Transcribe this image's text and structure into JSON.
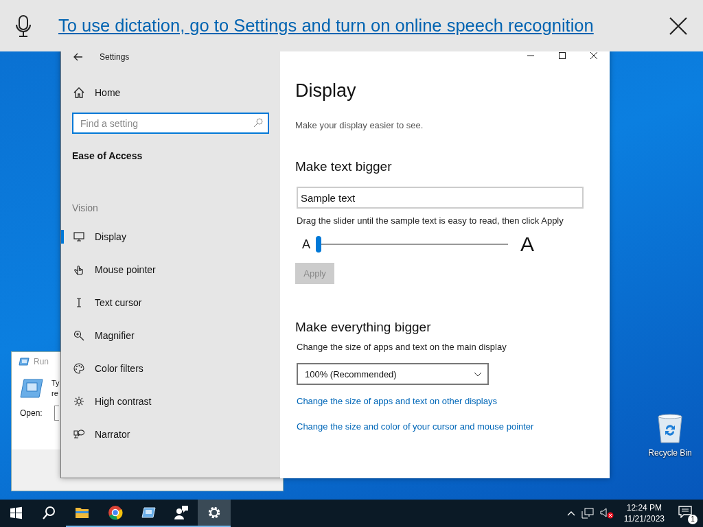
{
  "dictation_bar": {
    "message": "To use dictation, go to Settings and turn on online speech recognition"
  },
  "run_dialog": {
    "title": "Run",
    "description_lines": [
      "Ty",
      "re"
    ],
    "open_label": "Open:"
  },
  "settings": {
    "title": "Settings",
    "home": "Home",
    "search": {
      "placeholder": "Find a setting"
    },
    "category": "Ease of Access",
    "section": "Vision",
    "nav_items": [
      {
        "label": "Display",
        "kind": "display",
        "selected": true
      },
      {
        "label": "Mouse pointer",
        "kind": "pointer",
        "selected": false
      },
      {
        "label": "Text cursor",
        "kind": "cursor",
        "selected": false
      },
      {
        "label": "Magnifier",
        "kind": "magnifier",
        "selected": false
      },
      {
        "label": "Color filters",
        "kind": "palette",
        "selected": false
      },
      {
        "label": "High contrast",
        "kind": "contrast",
        "selected": false
      },
      {
        "label": "Narrator",
        "kind": "narrator",
        "selected": false
      }
    ],
    "page": {
      "title": "Display",
      "description": "Make your display easier to see.",
      "text_section": {
        "heading": "Make text bigger",
        "sample_value": "Sample text",
        "instruction": "Drag the slider until the sample text is easy to read, then click Apply",
        "slider": {
          "min_label": "A",
          "max_label": "A",
          "level": 0
        },
        "apply": {
          "label": "Apply",
          "disabled": true
        }
      },
      "everything_section": {
        "heading": "Make everything bigger",
        "caption": "Change the size of apps and text on the main display",
        "scale": {
          "value": "100% (Recommended)"
        },
        "links": [
          "Change the size of apps and text on other displays",
          "Change the size and color of your cursor and mouse pointer"
        ]
      }
    }
  },
  "desktop_icons": [
    {
      "label": "Recycle Bin"
    }
  ],
  "taskbar": {
    "apps": [
      {
        "kind": "start",
        "running": false,
        "selected": false
      },
      {
        "kind": "search",
        "running": false,
        "selected": false
      },
      {
        "kind": "folder",
        "running": true,
        "selected": false
      },
      {
        "kind": "browser",
        "running": true,
        "selected": false
      },
      {
        "kind": "run",
        "running": true,
        "selected": false
      },
      {
        "kind": "people",
        "running": true,
        "selected": false
      },
      {
        "kind": "settings",
        "running": true,
        "selected": true
      }
    ],
    "tray": {
      "time": "12:24 PM",
      "date": "11/21/2023",
      "notification_count": "1"
    }
  }
}
